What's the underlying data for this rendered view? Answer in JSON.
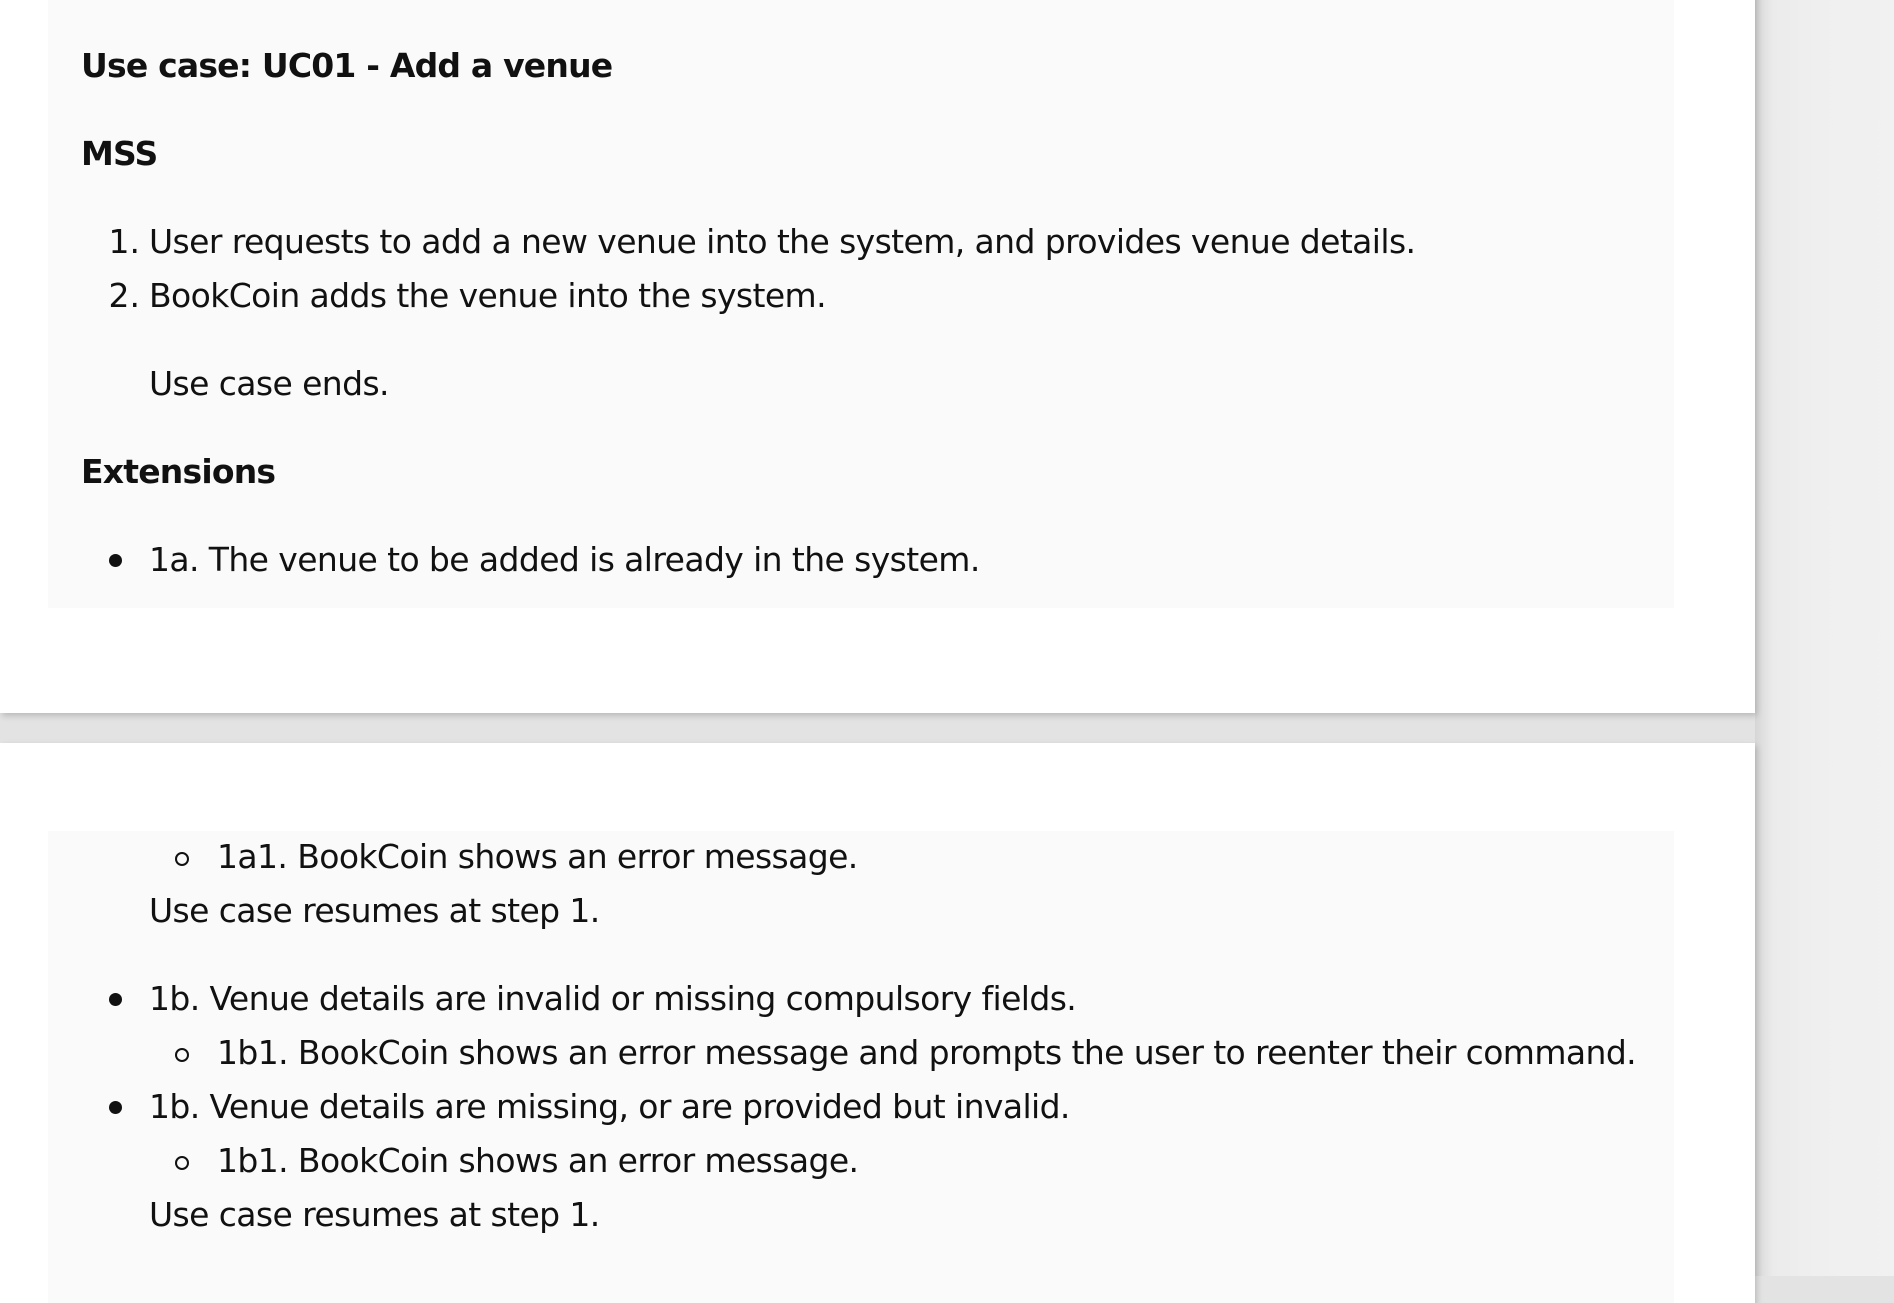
{
  "use_case": {
    "title": "Use case: UC01 - Add a venue",
    "mss_heading": "MSS",
    "steps": [
      {
        "num": "1.",
        "text": "User requests to add a new venue into the system, and provides venue details."
      },
      {
        "num": "2.",
        "text": "BookCoin adds the venue into the system."
      }
    ],
    "mss_end": "Use case ends.",
    "extensions_heading": "Extensions",
    "extensions": [
      {
        "text": "1a. The venue to be added is already in the system.",
        "sub": [
          {
            "text": "1a1. BookCoin shows an error message."
          }
        ],
        "resume": "Use case resumes at step 1."
      },
      {
        "text": "1b. Venue details are invalid or missing compulsory fields.",
        "sub": [
          {
            "text": "1b1. BookCoin shows an error message and prompts the user to reenter their command."
          }
        ]
      },
      {
        "text": "1b. Venue details are missing, or are provided but invalid.",
        "sub": [
          {
            "text": "1b1. BookCoin shows an error message."
          }
        ],
        "resume": "Use case resumes at step 1."
      }
    ]
  }
}
